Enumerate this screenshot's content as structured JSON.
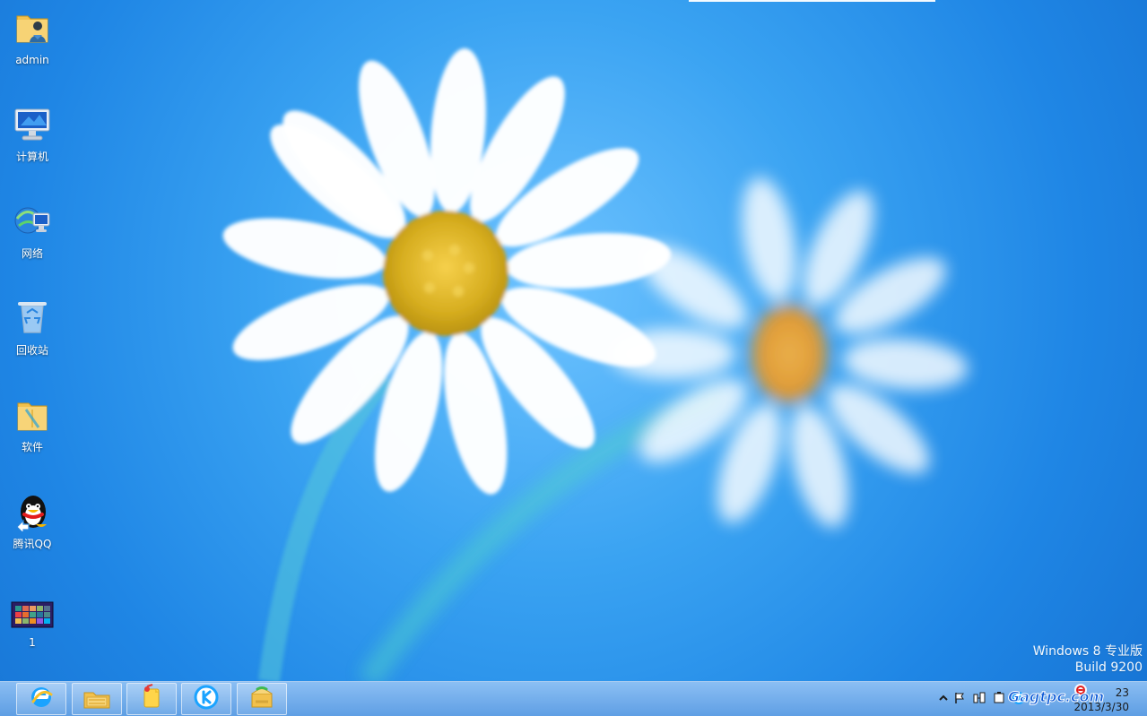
{
  "desktop": {
    "icons": [
      {
        "id": "admin",
        "label": "admin",
        "icon": "user-folder-icon"
      },
      {
        "id": "computer",
        "label": "计算机",
        "icon": "computer-icon"
      },
      {
        "id": "network",
        "label": "网络",
        "icon": "network-icon"
      },
      {
        "id": "recycle",
        "label": "回收站",
        "icon": "recycle-bin-icon"
      },
      {
        "id": "software",
        "label": "软件",
        "icon": "folder-icon"
      },
      {
        "id": "qq",
        "label": "腾讯QQ",
        "icon": "qq-penguin-icon"
      },
      {
        "id": "one",
        "label": "1",
        "icon": "windows-tiles-icon"
      }
    ]
  },
  "watermark": {
    "line1": "Windows 8 专业版",
    "line2": "Build 9200"
  },
  "taskbar": {
    "apps": [
      {
        "name": "Internet Explorer",
        "icon": "internet-explorer-icon"
      },
      {
        "name": "File Explorer",
        "icon": "file-explorer-icon"
      },
      {
        "name": "Sticky Notes",
        "icon": "sticky-notes-icon"
      },
      {
        "name": "K Player",
        "icon": "k-player-icon"
      },
      {
        "name": "Package Manager",
        "icon": "package-icon"
      }
    ],
    "tray": {
      "time": "23",
      "date": "2013/3/30"
    },
    "brand_overlay": "Gagtpc.com"
  }
}
